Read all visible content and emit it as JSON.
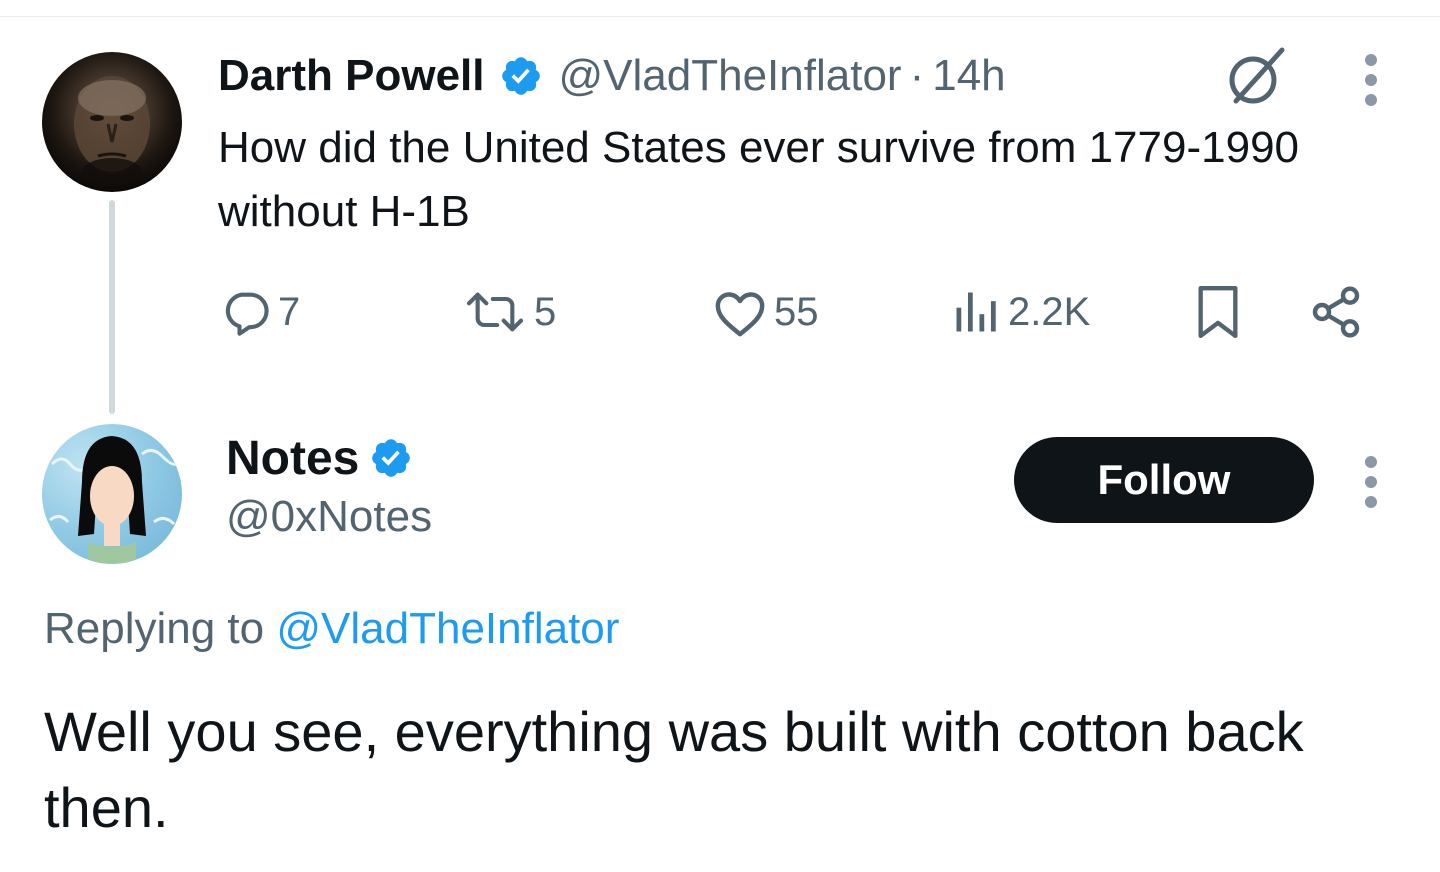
{
  "parent_tweet": {
    "display_name": "Darth Powell",
    "handle": "@VladTheInflator",
    "separator": "·",
    "timestamp": "14h",
    "text": "How did the United States ever survive from 1779-1990 without H-1B",
    "verified": true,
    "avatar": "portrait-avatar",
    "actions": {
      "replies": "7",
      "retweets": "5",
      "likes": "55",
      "views": "2.2K"
    },
    "icons": [
      "reply-icon",
      "retweet-icon",
      "like-icon",
      "views-icon",
      "bookmark-icon",
      "share-icon",
      "grok-icon",
      "more-icon"
    ]
  },
  "reply_tweet": {
    "display_name": "Notes",
    "handle": "@0xNotes",
    "verified": true,
    "avatar": "cartoon-avatar",
    "follow_label": "Follow",
    "replying_to_prefix": "Replying to ",
    "replying_to_handle": "@VladTheInflator",
    "text": "Well you see, everything was built with cotton back then."
  },
  "colors": {
    "text_primary": "#0f1419",
    "text_secondary": "#536471",
    "accent": "#1d9bf0",
    "verified": "#1d9bf0",
    "thread_line": "#cfd9de",
    "follow_button_bg": "#0f1419"
  }
}
